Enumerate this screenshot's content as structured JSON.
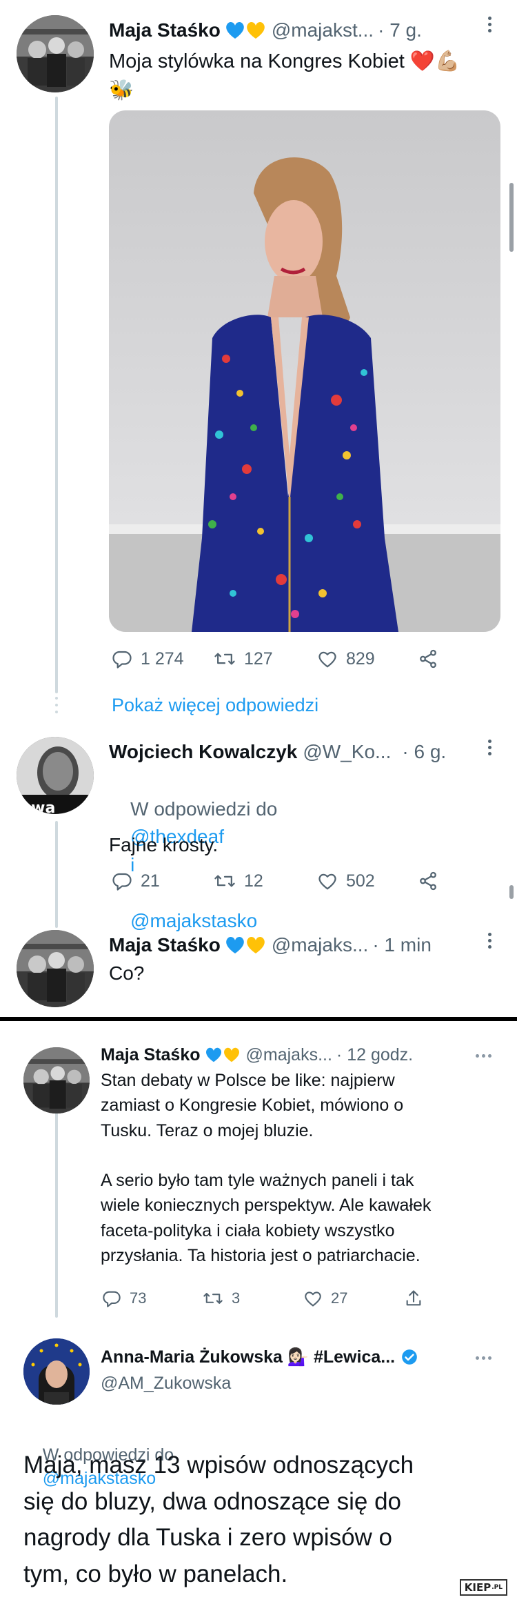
{
  "colors": {
    "link": "#1d9bf0",
    "secondary_text": "#536471",
    "thread_line": "#cfd9de",
    "heart_blue": "#1d9bf0",
    "heart_yellow": "#ffc107",
    "verified": "#1d9bf0"
  },
  "top_screen": {
    "tweet1": {
      "author_name": "Maja Staśko",
      "author_emoji": [
        "blue-heart-icon",
        "yellow-heart-icon"
      ],
      "handle": "@majakst...",
      "time": "· 7 g.",
      "text": "Moja stylówka na Kongres Kobiet ❤️💪🏼\n🐝",
      "photo_icon": "photo-woman-in-colorful-jumpsuit",
      "actions": {
        "replies": "1 274",
        "retweets": "127",
        "likes": "829"
      }
    },
    "show_more_replies": "Pokaż więcej odpowiedzi",
    "tweet2": {
      "author_name": "Wojciech Kowalczyk",
      "handle": "@W_Ko...",
      "time": "· 6 g.",
      "reply_prefix": "W odpowiedzi do",
      "reply_to_1": "@thexdeaf",
      "reply_and": "i",
      "reply_to_2": "@majakstasko",
      "text": "Fajne krosty.",
      "actions": {
        "replies": "21",
        "retweets": "12",
        "likes": "502"
      }
    },
    "tweet3": {
      "author_name": "Maja Staśko",
      "handle": "@majaks...",
      "time": "· 1 min",
      "text": "Co?"
    }
  },
  "bottom_screen": {
    "tweet4": {
      "author_name": "Maja Staśko",
      "handle": "@majaks...",
      "time": "· 12 godz.",
      "text": "Stan debaty w Polsce be like: najpierw\nzamiast o Kongresie Kobiet, mówiono o\nTusku. Teraz o mojej bluzie.\n\nA serio było tam tyle ważnych paneli i tak\nwiele koniecznych perspektyw. Ale kawałek\nfaceta-polityka i ciała kobiety wszystko\nprzysłania. Ta historia jest o patriarchacie.",
      "actions": {
        "replies": "73",
        "retweets": "3",
        "likes": "27"
      }
    },
    "tweet5": {
      "author_name": "Anna-Maria Żukowska 💁🏻‍♀️ #Lewica...",
      "handle": "@AM_Zukowska",
      "reply_prefix": "W odpowiedzi do",
      "reply_to": "@majakstasko",
      "text": "Maja, masz 13 wpisów odnoszących\nsię do bluzy, dwa odnoszące się do\nnagrody dla Tuska i zero wpisów o\ntym, co było w panelach."
    }
  },
  "watermark": {
    "main": "KIEP",
    "suffix": ".PL"
  }
}
